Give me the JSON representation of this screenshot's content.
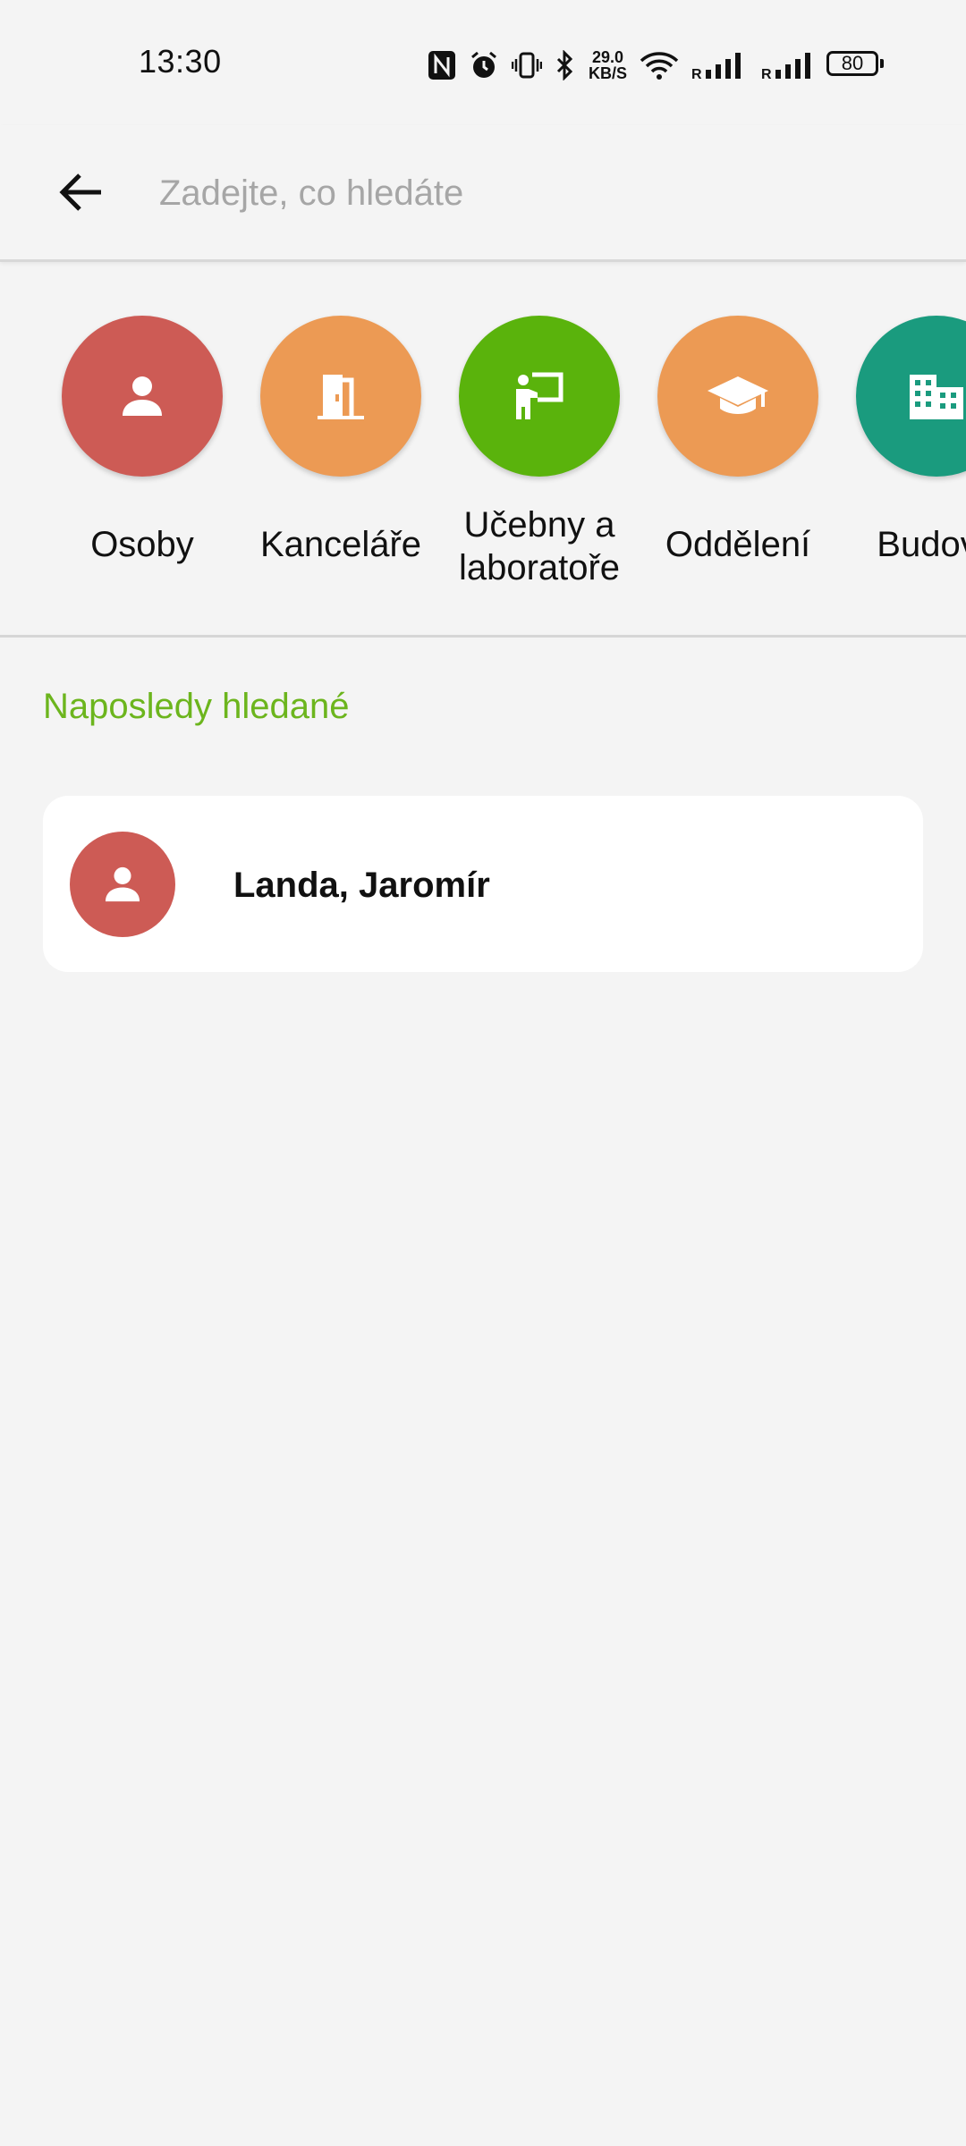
{
  "status": {
    "time": "13:30",
    "net_speed_value": "29.0",
    "net_speed_unit": "KB/S",
    "battery": "80"
  },
  "search": {
    "placeholder": "Zadejte, co hledáte",
    "value": ""
  },
  "categories": [
    {
      "label": "Osoby",
      "icon": "person-icon",
      "color": "#cd5b55"
    },
    {
      "label": "Kanceláře",
      "icon": "door-icon",
      "color": "#ec9a54"
    },
    {
      "label": "Učebny a laboratoře",
      "icon": "teacher-board-icon",
      "color": "#5ab30c"
    },
    {
      "label": "Oddělení",
      "icon": "graduation-cap-icon",
      "color": "#ec9a54"
    },
    {
      "label": "Budovy",
      "icon": "building-icon",
      "color": "#1a9b7e"
    }
  ],
  "recent": {
    "title": "Naposledy hledané",
    "items": [
      {
        "name": "Landa, Jaromír",
        "icon": "person-icon",
        "color": "#cd5b55"
      }
    ]
  }
}
